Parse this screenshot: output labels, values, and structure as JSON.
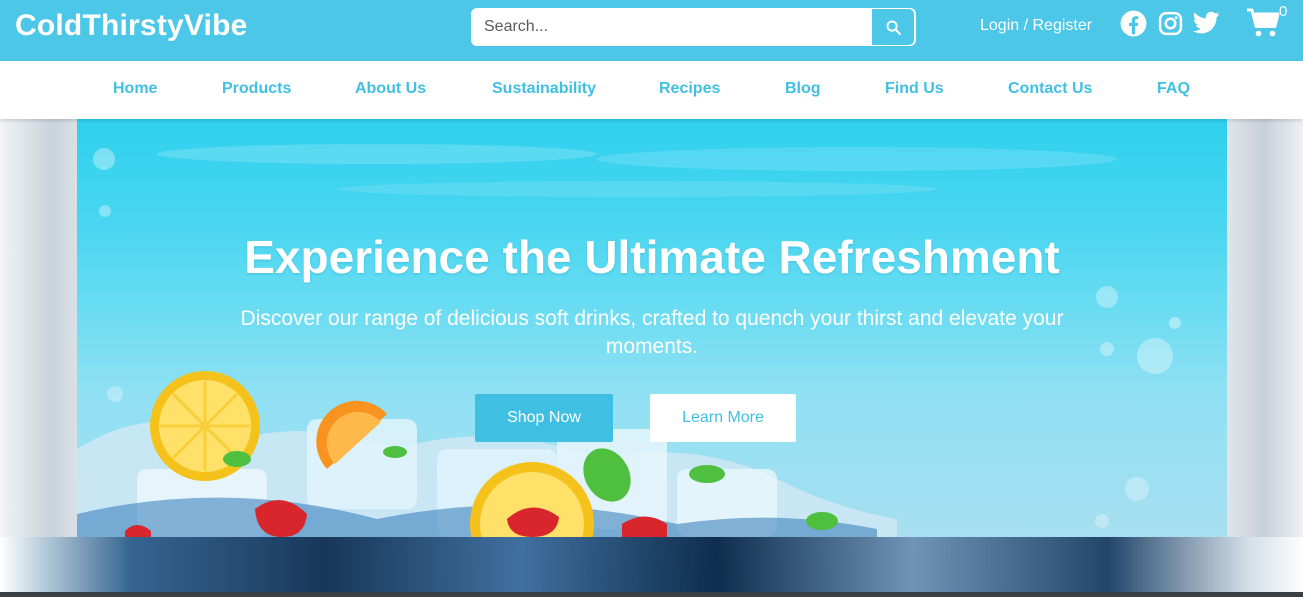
{
  "header": {
    "brand": "ColdThirstyVibe",
    "search_placeholder": "Search...",
    "login_label": "Login / Register",
    "cart_count": "0",
    "social_icons": [
      "facebook-icon",
      "instagram-icon",
      "twitter-icon"
    ]
  },
  "nav": {
    "items": [
      "Home",
      "Products",
      "About Us",
      "Sustainability",
      "Recipes",
      "Blog",
      "Find Us",
      "Contact Us",
      "FAQ"
    ]
  },
  "hero": {
    "title": "Experience the Ultimate Refreshment",
    "subtitle": "Discover our range of delicious soft drinks, crafted to quench your thirst and elevate your moments.",
    "primary_button": "Shop Now",
    "secondary_button": "Learn More"
  },
  "colors": {
    "brand": "#4cc7e8",
    "accent_text": "#3fc0e3",
    "white": "#ffffff"
  }
}
